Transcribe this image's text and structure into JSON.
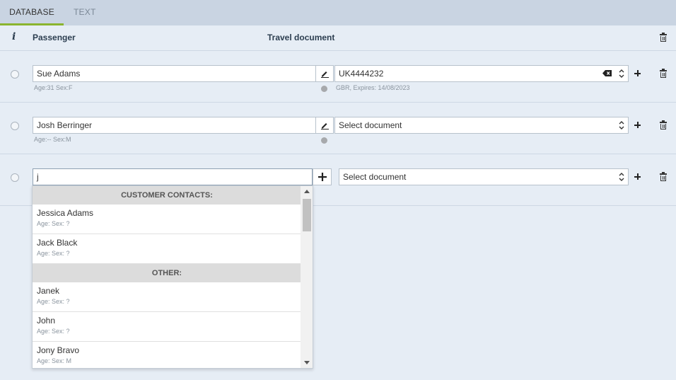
{
  "tabs": [
    {
      "label": "DATABASE",
      "active": true
    },
    {
      "label": "TEXT",
      "active": false
    }
  ],
  "header": {
    "info": "i",
    "passenger": "Passenger",
    "travel_document": "Travel document"
  },
  "rows": [
    {
      "passenger": "Sue Adams",
      "passenger_sub": "Age:31 Sex:F",
      "document": "UK4444232",
      "document_sub": "GBR, Expires: 14/08/2023"
    },
    {
      "passenger": "Josh Berringer",
      "passenger_sub": "Age:-- Sex:M",
      "document": "Select document"
    },
    {
      "passenger": "j",
      "document": "Select document"
    }
  ],
  "dropdown": {
    "groups": [
      {
        "title": "CUSTOMER CONTACTS:",
        "items": [
          {
            "name": "Jessica Adams",
            "sub": "Age: Sex: ?"
          },
          {
            "name": "Jack Black",
            "sub": "Age: Sex: ?"
          }
        ]
      },
      {
        "title": "OTHER:",
        "items": [
          {
            "name": "Janek",
            "sub": "Age: Sex: ?"
          },
          {
            "name": "John",
            "sub": "Age: Sex: ?"
          },
          {
            "name": "Jony Bravo",
            "sub": "Age: Sex: M"
          }
        ]
      }
    ]
  },
  "colors": {
    "background": "#e6edf5",
    "tab_bar": "#c9d4e2",
    "active_tab_underline": "#8ab42e"
  }
}
